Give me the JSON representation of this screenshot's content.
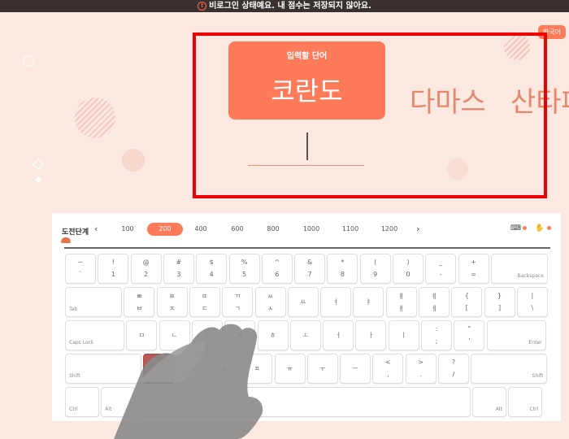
{
  "top_bar": {
    "notice": "비로그인 상태예요. 내 점수는 저장되지 않아요."
  },
  "language_button": "한국어",
  "word_card": {
    "label": "입력할 단어",
    "current_word": "코란도"
  },
  "upcoming_words": [
    "다마스",
    "산타페"
  ],
  "level_bar": {
    "title": "도전단계",
    "levels": [
      "100",
      "200",
      "400",
      "600",
      "800",
      "1000",
      "1100",
      "1200"
    ],
    "active_level": "200"
  },
  "colors": {
    "accent": "#ff7a59",
    "background": "#fbe9e1",
    "highlight_frame": "#ee0000",
    "pressed_key": "#b9595a"
  },
  "keyboard": {
    "rows": [
      [
        {
          "top": "~",
          "bottom": "`"
        },
        {
          "top": "!",
          "bottom": "1"
        },
        {
          "top": "@",
          "bottom": "2"
        },
        {
          "top": "#",
          "bottom": "3"
        },
        {
          "top": "$",
          "bottom": "4"
        },
        {
          "top": "%",
          "bottom": "5"
        },
        {
          "top": "^",
          "bottom": "6"
        },
        {
          "top": "&",
          "bottom": "7"
        },
        {
          "top": "*",
          "bottom": "8"
        },
        {
          "top": "(",
          "bottom": "9"
        },
        {
          "top": ")",
          "bottom": "0"
        },
        {
          "top": "_",
          "bottom": "-"
        },
        {
          "top": "+",
          "bottom": "="
        },
        {
          "mod_right": "Backspace"
        }
      ],
      [
        {
          "mod": "Tab"
        },
        {
          "top": "ㅃ",
          "bottom": "ㅂ"
        },
        {
          "top": "ㅉ",
          "bottom": "ㅈ"
        },
        {
          "top": "ㄸ",
          "bottom": "ㄷ"
        },
        {
          "top": "ㄲ",
          "bottom": "ㄱ"
        },
        {
          "top": "ㅆ",
          "bottom": "ㅅ"
        },
        {
          "mid": "ㅛ"
        },
        {
          "mid": "ㅕ"
        },
        {
          "mid": "ㅑ"
        },
        {
          "top": "ㅒ",
          "bottom": "ㅐ"
        },
        {
          "top": "ㅖ",
          "bottom": "ㅔ"
        },
        {
          "top": "{",
          "bottom": "["
        },
        {
          "top": "}",
          "bottom": "]"
        },
        {
          "top": "|",
          "bottom": "\\"
        }
      ],
      [
        {
          "mod": "Caps Lock"
        },
        {
          "mid": "ㅁ"
        },
        {
          "mid": "ㄴ"
        },
        {
          "mid": "ㅇ"
        },
        {
          "mid": "ㄹ"
        },
        {
          "mid": "ㅎ"
        },
        {
          "mid": "ㅗ"
        },
        {
          "mid": "ㅓ"
        },
        {
          "mid": "ㅏ"
        },
        {
          "mid": "ㅣ"
        },
        {
          "top": ":",
          "bottom": ";"
        },
        {
          "top": "\"",
          "bottom": "'"
        },
        {
          "mod_right": "Enter"
        }
      ],
      [
        {
          "mod": "Shift"
        },
        {
          "mid": "ㅋ"
        },
        {
          "mid": "ㅌ"
        },
        {
          "mid": "ㅊ"
        },
        {
          "mid": "ㅍ"
        },
        {
          "mid": "ㅠ"
        },
        {
          "mid": "ㅜ"
        },
        {
          "mid": "ㅡ"
        },
        {
          "top": "<",
          "bottom": ","
        },
        {
          "top": ">",
          "bottom": "."
        },
        {
          "top": "?",
          "bottom": "/"
        },
        {
          "mod_right": "Shift"
        }
      ],
      [
        {
          "mod": "Ctrl"
        },
        {
          "mod": "Alt"
        },
        {
          "mid": ""
        },
        {
          "mod_right": "Alt"
        },
        {
          "mod_right": "Ctrl"
        }
      ]
    ],
    "pressed_key": "ㅋ"
  }
}
